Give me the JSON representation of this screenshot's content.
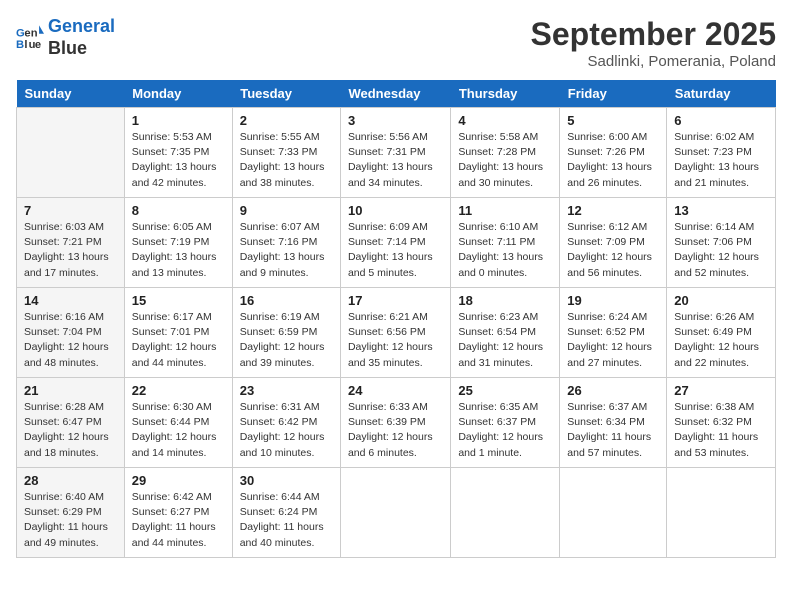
{
  "logo": {
    "line1": "General",
    "line2": "Blue"
  },
  "title": "September 2025",
  "subtitle": "Sadlinki, Pomerania, Poland",
  "days_of_week": [
    "Sunday",
    "Monday",
    "Tuesday",
    "Wednesday",
    "Thursday",
    "Friday",
    "Saturday"
  ],
  "weeks": [
    [
      {
        "num": "",
        "info": ""
      },
      {
        "num": "1",
        "info": "Sunrise: 5:53 AM\nSunset: 7:35 PM\nDaylight: 13 hours\nand 42 minutes."
      },
      {
        "num": "2",
        "info": "Sunrise: 5:55 AM\nSunset: 7:33 PM\nDaylight: 13 hours\nand 38 minutes."
      },
      {
        "num": "3",
        "info": "Sunrise: 5:56 AM\nSunset: 7:31 PM\nDaylight: 13 hours\nand 34 minutes."
      },
      {
        "num": "4",
        "info": "Sunrise: 5:58 AM\nSunset: 7:28 PM\nDaylight: 13 hours\nand 30 minutes."
      },
      {
        "num": "5",
        "info": "Sunrise: 6:00 AM\nSunset: 7:26 PM\nDaylight: 13 hours\nand 26 minutes."
      },
      {
        "num": "6",
        "info": "Sunrise: 6:02 AM\nSunset: 7:23 PM\nDaylight: 13 hours\nand 21 minutes."
      }
    ],
    [
      {
        "num": "7",
        "info": "Sunrise: 6:03 AM\nSunset: 7:21 PM\nDaylight: 13 hours\nand 17 minutes."
      },
      {
        "num": "8",
        "info": "Sunrise: 6:05 AM\nSunset: 7:19 PM\nDaylight: 13 hours\nand 13 minutes."
      },
      {
        "num": "9",
        "info": "Sunrise: 6:07 AM\nSunset: 7:16 PM\nDaylight: 13 hours\nand 9 minutes."
      },
      {
        "num": "10",
        "info": "Sunrise: 6:09 AM\nSunset: 7:14 PM\nDaylight: 13 hours\nand 5 minutes."
      },
      {
        "num": "11",
        "info": "Sunrise: 6:10 AM\nSunset: 7:11 PM\nDaylight: 13 hours\nand 0 minutes."
      },
      {
        "num": "12",
        "info": "Sunrise: 6:12 AM\nSunset: 7:09 PM\nDaylight: 12 hours\nand 56 minutes."
      },
      {
        "num": "13",
        "info": "Sunrise: 6:14 AM\nSunset: 7:06 PM\nDaylight: 12 hours\nand 52 minutes."
      }
    ],
    [
      {
        "num": "14",
        "info": "Sunrise: 6:16 AM\nSunset: 7:04 PM\nDaylight: 12 hours\nand 48 minutes."
      },
      {
        "num": "15",
        "info": "Sunrise: 6:17 AM\nSunset: 7:01 PM\nDaylight: 12 hours\nand 44 minutes."
      },
      {
        "num": "16",
        "info": "Sunrise: 6:19 AM\nSunset: 6:59 PM\nDaylight: 12 hours\nand 39 minutes."
      },
      {
        "num": "17",
        "info": "Sunrise: 6:21 AM\nSunset: 6:56 PM\nDaylight: 12 hours\nand 35 minutes."
      },
      {
        "num": "18",
        "info": "Sunrise: 6:23 AM\nSunset: 6:54 PM\nDaylight: 12 hours\nand 31 minutes."
      },
      {
        "num": "19",
        "info": "Sunrise: 6:24 AM\nSunset: 6:52 PM\nDaylight: 12 hours\nand 27 minutes."
      },
      {
        "num": "20",
        "info": "Sunrise: 6:26 AM\nSunset: 6:49 PM\nDaylight: 12 hours\nand 22 minutes."
      }
    ],
    [
      {
        "num": "21",
        "info": "Sunrise: 6:28 AM\nSunset: 6:47 PM\nDaylight: 12 hours\nand 18 minutes."
      },
      {
        "num": "22",
        "info": "Sunrise: 6:30 AM\nSunset: 6:44 PM\nDaylight: 12 hours\nand 14 minutes."
      },
      {
        "num": "23",
        "info": "Sunrise: 6:31 AM\nSunset: 6:42 PM\nDaylight: 12 hours\nand 10 minutes."
      },
      {
        "num": "24",
        "info": "Sunrise: 6:33 AM\nSunset: 6:39 PM\nDaylight: 12 hours\nand 6 minutes."
      },
      {
        "num": "25",
        "info": "Sunrise: 6:35 AM\nSunset: 6:37 PM\nDaylight: 12 hours\nand 1 minute."
      },
      {
        "num": "26",
        "info": "Sunrise: 6:37 AM\nSunset: 6:34 PM\nDaylight: 11 hours\nand 57 minutes."
      },
      {
        "num": "27",
        "info": "Sunrise: 6:38 AM\nSunset: 6:32 PM\nDaylight: 11 hours\nand 53 minutes."
      }
    ],
    [
      {
        "num": "28",
        "info": "Sunrise: 6:40 AM\nSunset: 6:29 PM\nDaylight: 11 hours\nand 49 minutes."
      },
      {
        "num": "29",
        "info": "Sunrise: 6:42 AM\nSunset: 6:27 PM\nDaylight: 11 hours\nand 44 minutes."
      },
      {
        "num": "30",
        "info": "Sunrise: 6:44 AM\nSunset: 6:24 PM\nDaylight: 11 hours\nand 40 minutes."
      },
      {
        "num": "",
        "info": ""
      },
      {
        "num": "",
        "info": ""
      },
      {
        "num": "",
        "info": ""
      },
      {
        "num": "",
        "info": ""
      }
    ]
  ]
}
